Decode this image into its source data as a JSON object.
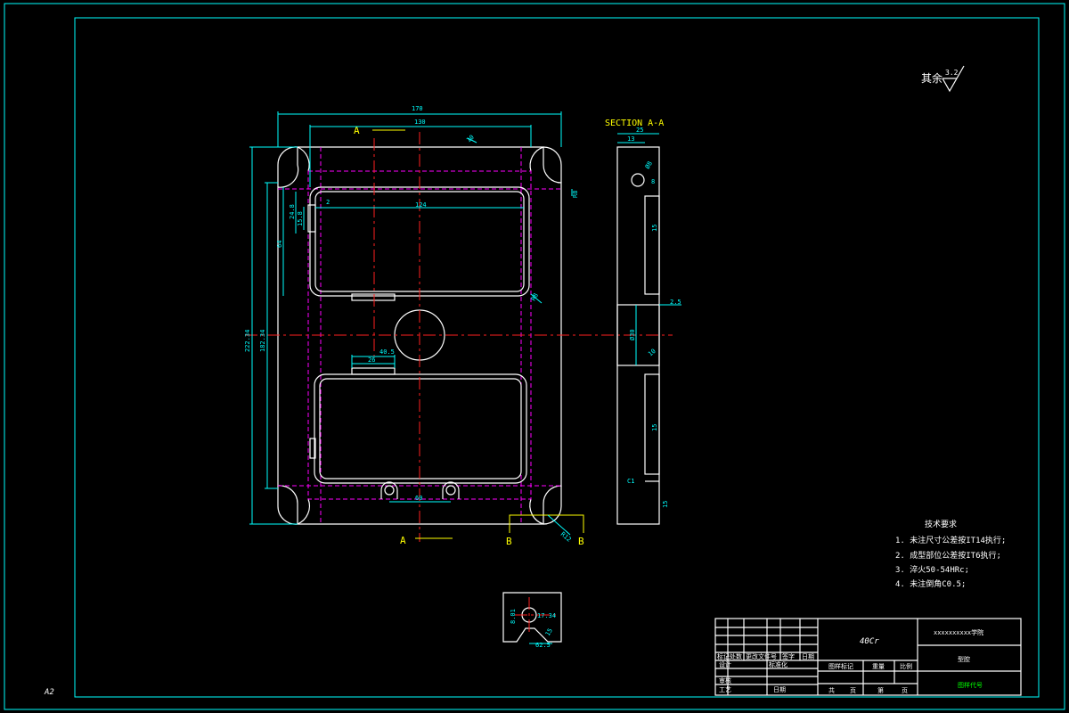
{
  "sheet": {
    "size_label": "A2"
  },
  "roughness": {
    "prefix": "其余",
    "value": "3.2"
  },
  "main_view": {
    "dims": {
      "overall_width": "170",
      "inner_width": "130",
      "pocket_width": "124",
      "overall_height": "222.34",
      "inner_height": "182.34",
      "left_64": "64",
      "left_24_8": "24.8",
      "left_15_8": "15.8",
      "top_2": "2",
      "slot_40_5": "40.5",
      "slot_26": "26",
      "holes_60": "60",
      "r_small": "R8",
      "r_corner": "R12",
      "top_chamfer": "10",
      "right_small": "R8"
    },
    "section_marks": {
      "a_top": "A",
      "a_bottom": "A",
      "b_left": "B",
      "b_right": "B"
    }
  },
  "section_view": {
    "title": "SECTION  A-A",
    "dims": {
      "w25": "25",
      "w13": "13",
      "hole": "Ø8",
      "d8": "8",
      "d15_top": "15",
      "d2_5": "2.5",
      "d30": "Ø30",
      "d10": "10",
      "d15_bottom": "15",
      "c1": "C1",
      "d15_end": "15"
    }
  },
  "detail_view": {
    "dims": {
      "d8": "8.01",
      "d1734": "17.34",
      "d15": "15",
      "d625": "62.5"
    }
  },
  "tech_requirements": {
    "title": "技术要求",
    "items": [
      "1. 未注尺寸公差按IT14执行;",
      "2. 成型部位公差按IT6执行;",
      "3. 淬火50-54HRc;",
      "4. 未注倒角C0.5;"
    ]
  },
  "title_block": {
    "material": "40Cr",
    "school": "xxxxxxxxxx学院",
    "drawing_name": "型腔",
    "drawing_no": "图样代号",
    "labels": {
      "mark": "标记",
      "count": "处数",
      "doc_no": "更改文件号",
      "sign": "签字",
      "date": "日期",
      "design": "设计",
      "standard": "标准化",
      "review": "审核",
      "process": "工艺",
      "date2": "日期",
      "stage": "图样标记",
      "weight": "重量",
      "scale": "比例",
      "total": "共",
      "page": "页",
      "sheet_no": "第",
      "page2": "页"
    }
  }
}
